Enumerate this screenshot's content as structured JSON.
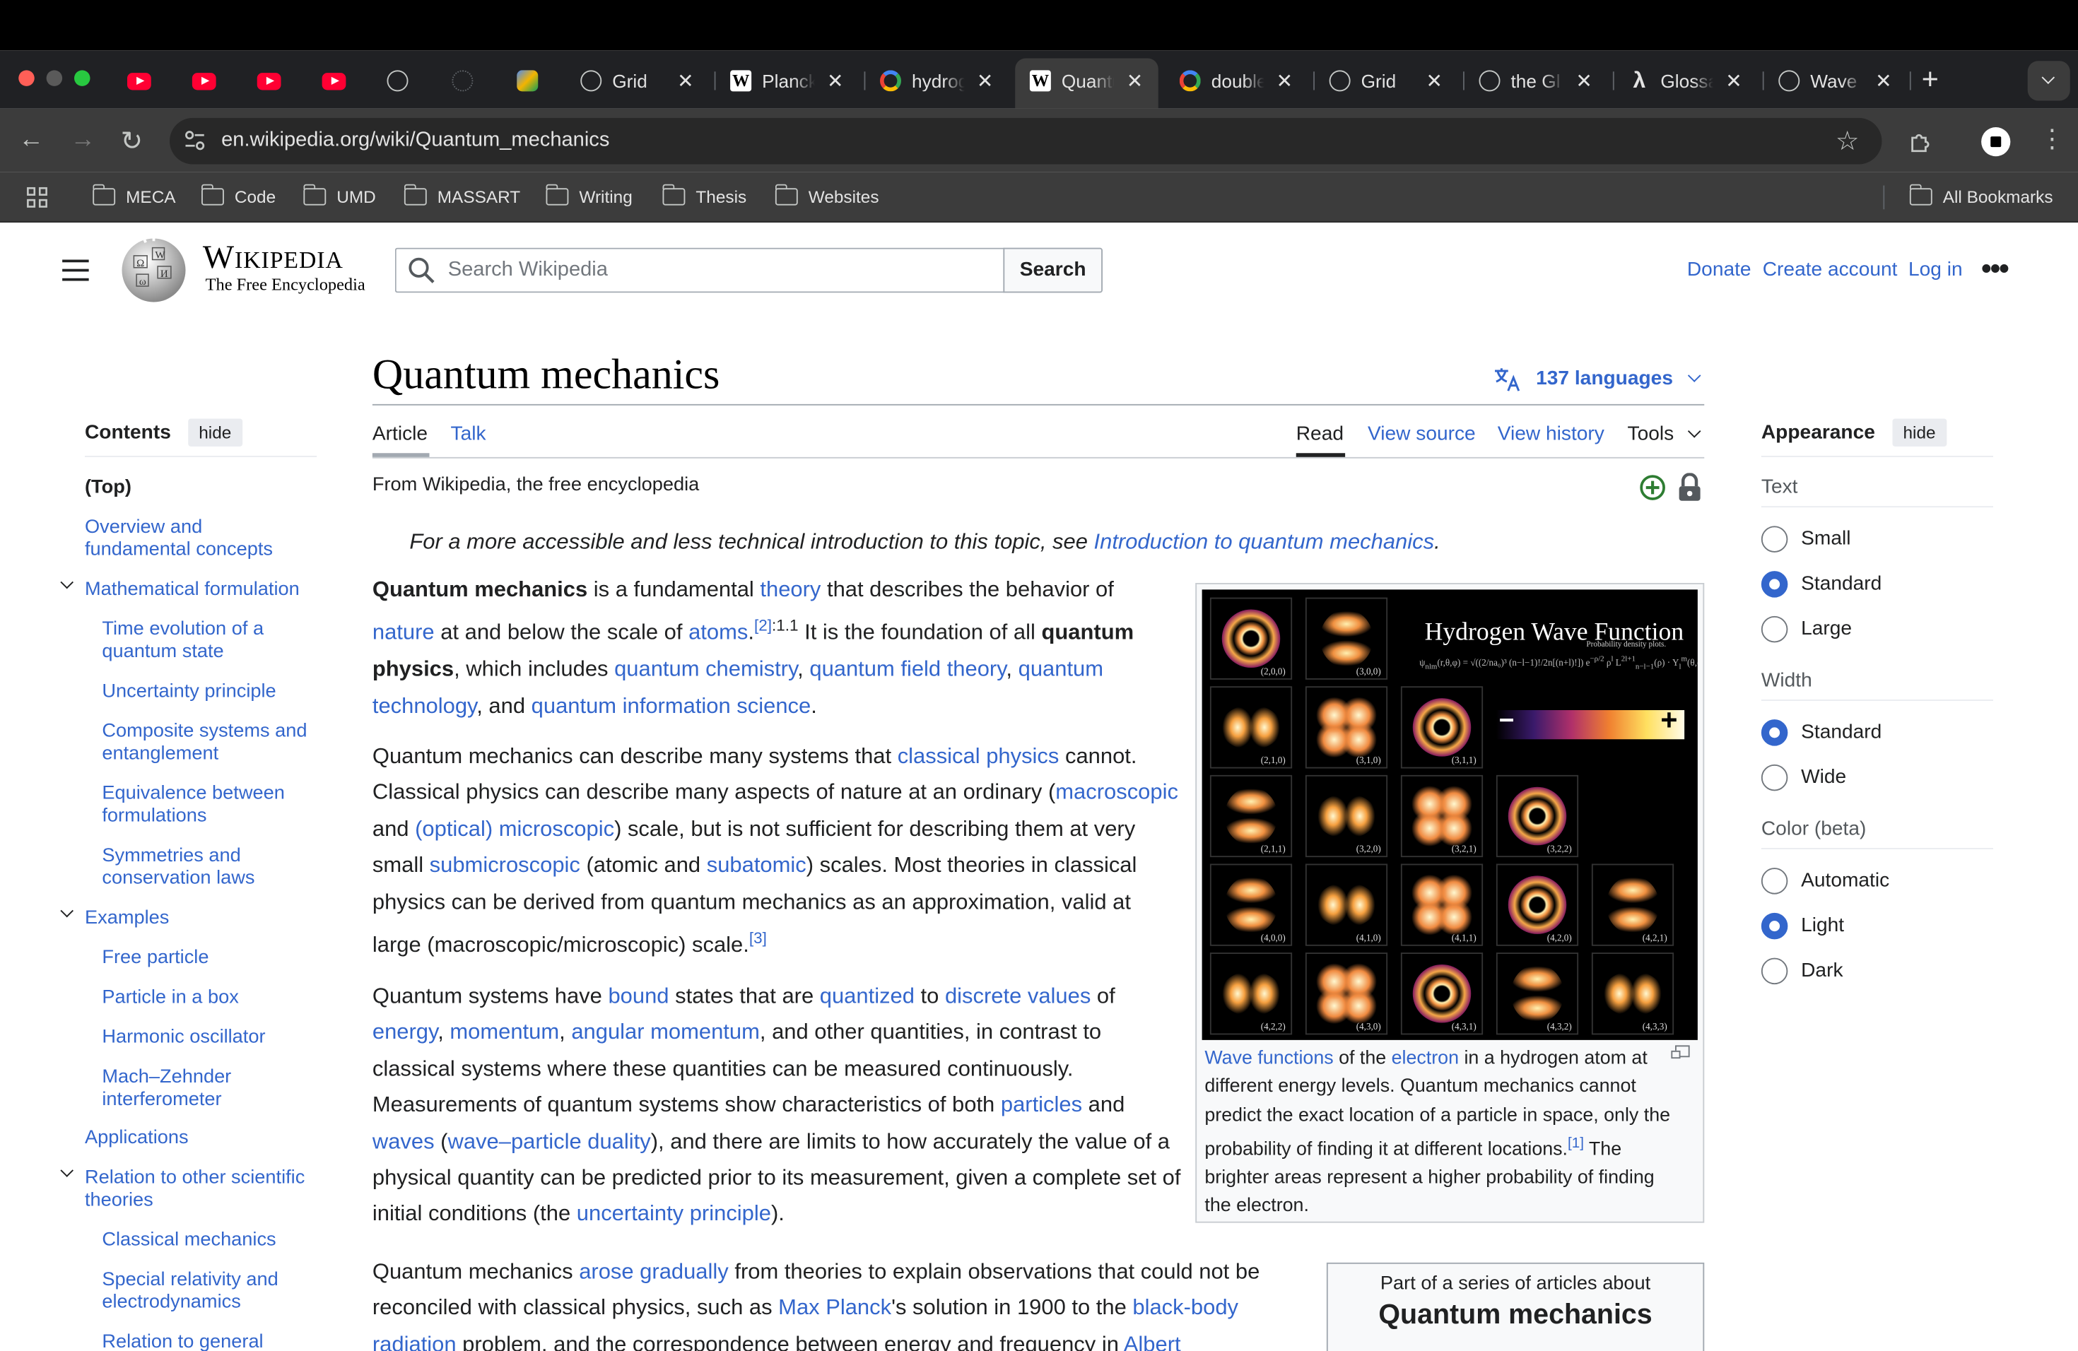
{
  "browser": {
    "tabs": [
      {
        "title": "",
        "icon": "youtube-icon"
      },
      {
        "title": "",
        "icon": "youtube-icon"
      },
      {
        "title": "",
        "icon": "youtube-icon"
      },
      {
        "title": "",
        "icon": "youtube-icon"
      },
      {
        "title": "",
        "icon": "globe-icon"
      },
      {
        "title": "",
        "icon": "loading-icon"
      },
      {
        "title": "",
        "icon": "app-icon"
      },
      {
        "title": "Grid",
        "icon": "globe-icon"
      },
      {
        "title": "Planck",
        "icon": "wikipedia-icon"
      },
      {
        "title": "hydrogen",
        "icon": "google-icon"
      },
      {
        "title": "Quantum",
        "icon": "wikipedia-icon",
        "active": true
      },
      {
        "title": "double",
        "icon": "google-icon"
      },
      {
        "title": "Grid",
        "icon": "globe-icon"
      },
      {
        "title": "the Gl",
        "icon": "globe-icon"
      },
      {
        "title": "Glossary",
        "icon": "lambda-icon"
      },
      {
        "title": "Wave",
        "icon": "globe-icon"
      }
    ],
    "url": "en.wikipedia.org/wiki/Quantum_mechanics",
    "bookmarks": [
      "MECA",
      "Code",
      "UMD",
      "MASSART",
      "Writing",
      "Thesis",
      "Websites"
    ],
    "all_bookmarks": "All Bookmarks",
    "new_tab": "+"
  },
  "wiki": {
    "logo_title": "Wikipedia",
    "logo_tagline": "The Free Encyclopedia",
    "search_placeholder": "Search Wikipedia",
    "search_button": "Search",
    "donate": "Donate",
    "create_account": "Create account",
    "log_in": "Log in",
    "page_title": "Quantum mechanics",
    "languages": "137 languages",
    "tab_article": "Article",
    "tab_talk": "Talk",
    "tab_read": "Read",
    "tab_view_source": "View source",
    "tab_view_history": "View history",
    "tab_tools": "Tools",
    "from": "From Wikipedia, the free encyclopedia",
    "hatnote_text": "For a more accessible and less technical introduction to this topic, see ",
    "hatnote_link": "Introduction to quantum mechanics",
    "hatnote_end": "."
  },
  "toc": {
    "title": "Contents",
    "hide": "hide",
    "items": [
      {
        "label": "(Top)"
      },
      {
        "label": "Overview and fundamental concepts"
      },
      {
        "label": "Mathematical formulation"
      },
      {
        "label": "Time evolution of a quantum state"
      },
      {
        "label": "Uncertainty principle"
      },
      {
        "label": "Composite systems and entanglement"
      },
      {
        "label": "Equivalence between formulations"
      },
      {
        "label": "Symmetries and conservation laws"
      },
      {
        "label": "Examples"
      },
      {
        "label": "Free particle"
      },
      {
        "label": "Particle in a box"
      },
      {
        "label": "Harmonic oscillator"
      },
      {
        "label": "Mach–Zehnder interferometer"
      },
      {
        "label": "Applications"
      },
      {
        "label": "Relation to other scientific theories"
      },
      {
        "label": "Classical mechanics"
      },
      {
        "label": "Special relativity and electrodynamics"
      },
      {
        "label": "Relation to general"
      }
    ]
  },
  "appearance": {
    "title": "Appearance",
    "hide": "hide",
    "text_head": "Text",
    "text_opts": [
      "Small",
      "Standard",
      "Large"
    ],
    "text_selected": "Standard",
    "width_head": "Width",
    "width_opts": [
      "Standard",
      "Wide"
    ],
    "width_selected": "Standard",
    "color_head": "Color (beta)",
    "color_opts": [
      "Automatic",
      "Light",
      "Dark"
    ],
    "color_selected": "Light"
  },
  "figure": {
    "title": "Hydrogen Wave Function",
    "subtitle": "Probability density plots.",
    "labels": [
      "(2,0,0)",
      "(3,0,0)",
      "(2,1,0)",
      "(3,1,0)",
      "(3,1,1)",
      "(2,1,1)",
      "(3,2,0)",
      "(3,2,1)",
      "(3,2,2)",
      "(4,0,0)",
      "(4,1,0)",
      "(4,1,1)",
      "(4,2,0)",
      "(4,2,1)",
      "(4,2,2)",
      "(4,3,0)",
      "(4,3,1)",
      "(4,3,2)",
      "(4,3,3)"
    ],
    "colorbar_minus": "−",
    "colorbar_plus": "+",
    "caption_link1": "Wave functions",
    "caption_t1": " of the ",
    "caption_link2": "electron",
    "caption_t2": " in a hydrogen atom at different energy levels. Quantum mechanics cannot predict the exact location of a particle in space, only the probability of finding it at different locations.",
    "caption_ref": "[1]",
    "caption_t3": " The brighter areas represent a higher probability of finding the electron."
  },
  "sidebox": {
    "pre": "Part of a series of articles about",
    "title": "Quantum mechanics"
  },
  "colors": {
    "link": "#3366cc",
    "text": "#202122",
    "chrome_dark": "#202124"
  }
}
